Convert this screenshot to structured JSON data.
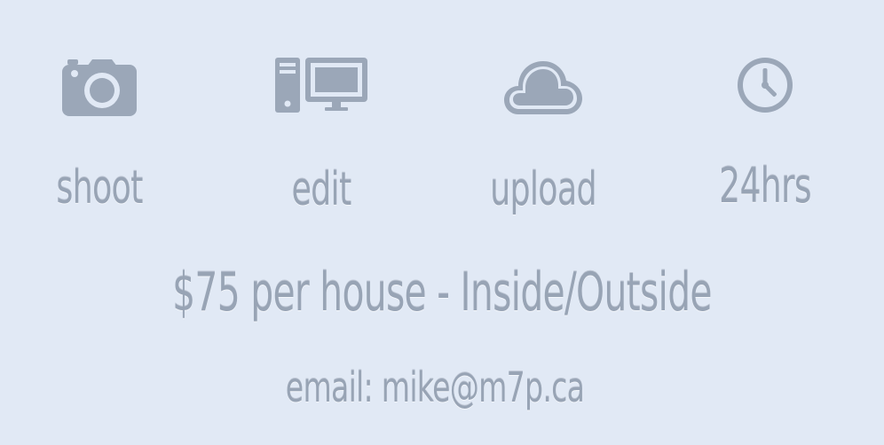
{
  "colors": {
    "background": "#e1e9f5",
    "icon": "#9ba7b8",
    "text": "#98a4b5"
  },
  "steps": [
    {
      "icon": "camera-icon",
      "label": "shoot"
    },
    {
      "icon": "computer-icon",
      "label": "edit"
    },
    {
      "icon": "cloud-icon",
      "label": "upload"
    },
    {
      "icon": "clock-icon",
      "label": "24hrs"
    }
  ],
  "price_text": "$75 per house - Inside/Outside",
  "email_text": "email: mike@m7p.ca"
}
